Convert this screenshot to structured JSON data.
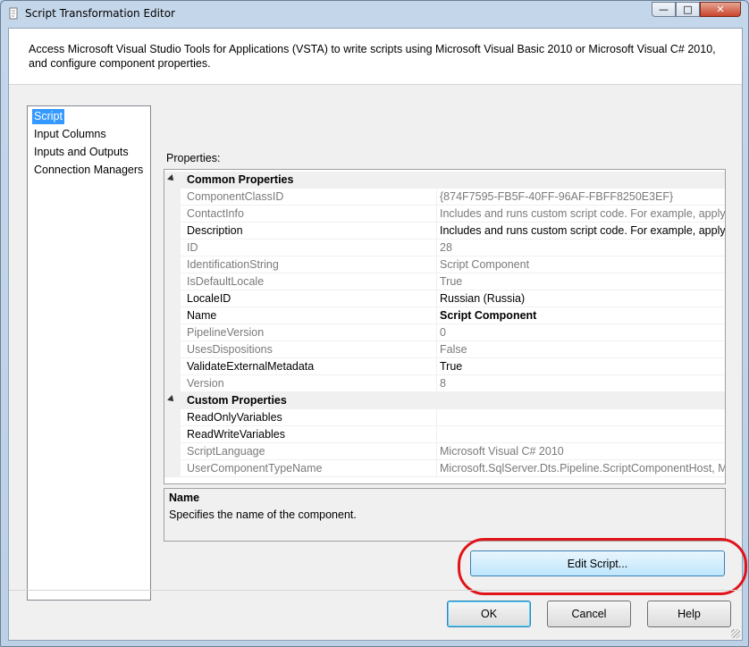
{
  "window": {
    "title": "Script Transformation Editor"
  },
  "header": {
    "description": "Access Microsoft Visual Studio Tools for Applications (VSTA) to write scripts using Microsoft Visual Basic 2010 or Microsoft Visual C# 2010, and configure component properties."
  },
  "nav": {
    "items": [
      {
        "label": "Script",
        "selected": true
      },
      {
        "label": "Input Columns"
      },
      {
        "label": "Inputs and Outputs"
      },
      {
        "label": "Connection Managers"
      }
    ]
  },
  "properties": {
    "label": "Properties:",
    "categories": [
      {
        "name": "Common Properties",
        "rows": [
          {
            "name": "ComponentClassID",
            "value": "{874F7595-FB5F-40FF-96AF-FBFF8250E3EF}",
            "readonly": true
          },
          {
            "name": "ContactInfo",
            "value": "Includes and runs custom script code. For example, apply a b",
            "readonly": true
          },
          {
            "name": "Description",
            "value": "Includes and runs custom script code. For example, apply a b"
          },
          {
            "name": "ID",
            "value": "28",
            "readonly": true
          },
          {
            "name": "IdentificationString",
            "value": "Script Component",
            "readonly": true
          },
          {
            "name": "IsDefaultLocale",
            "value": "True",
            "readonly": true
          },
          {
            "name": "LocaleID",
            "value": "Russian (Russia)"
          },
          {
            "name": "Name",
            "value": "Script Component",
            "bold": true
          },
          {
            "name": "PipelineVersion",
            "value": "0",
            "readonly": true
          },
          {
            "name": "UsesDispositions",
            "value": "False",
            "readonly": true
          },
          {
            "name": "ValidateExternalMetadata",
            "value": "True"
          },
          {
            "name": "Version",
            "value": "8",
            "readonly": true
          }
        ]
      },
      {
        "name": "Custom Properties",
        "rows": [
          {
            "name": "ReadOnlyVariables",
            "value": ""
          },
          {
            "name": "ReadWriteVariables",
            "value": ""
          },
          {
            "name": "ScriptLanguage",
            "value": "Microsoft Visual C# 2010",
            "readonly": true
          },
          {
            "name": "UserComponentTypeName",
            "value": "Microsoft.SqlServer.Dts.Pipeline.ScriptComponentHost, Micr",
            "readonly": true
          }
        ]
      }
    ]
  },
  "description_panel": {
    "title": "Name",
    "text": "Specifies the name of the component."
  },
  "buttons": {
    "edit_script": "Edit Script...",
    "ok": "OK",
    "cancel": "Cancel",
    "help": "Help"
  },
  "colors": {
    "selection": "#3399ff",
    "highlight_ring": "#e0141a"
  }
}
